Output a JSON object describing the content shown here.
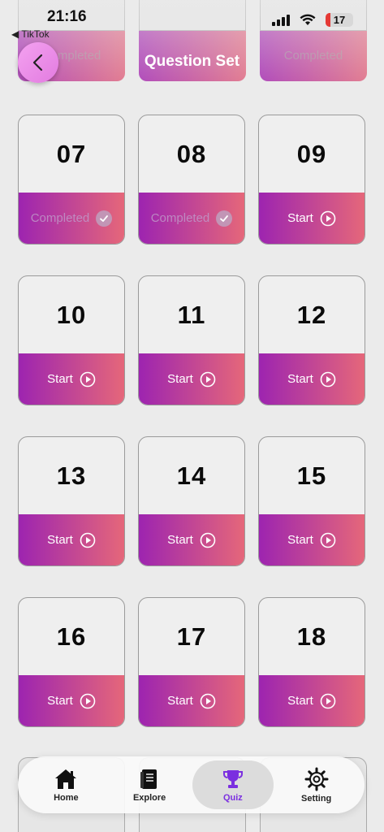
{
  "status": {
    "time": "21:16",
    "back_app": "◀ TikTok",
    "battery": "17"
  },
  "header": {
    "title": "Question Set"
  },
  "top_ghost": [
    {
      "label": "Completed"
    },
    {
      "label": ""
    },
    {
      "label": "Completed"
    }
  ],
  "cards": [
    {
      "number": "07",
      "action": "Completed",
      "status": "completed"
    },
    {
      "number": "08",
      "action": "Completed",
      "status": "completed"
    },
    {
      "number": "09",
      "action": "Start",
      "status": "start"
    },
    {
      "number": "10",
      "action": "Start",
      "status": "start"
    },
    {
      "number": "11",
      "action": "Start",
      "status": "start"
    },
    {
      "number": "12",
      "action": "Start",
      "status": "start"
    },
    {
      "number": "13",
      "action": "Start",
      "status": "start"
    },
    {
      "number": "14",
      "action": "Start",
      "status": "start"
    },
    {
      "number": "15",
      "action": "Start",
      "status": "start"
    },
    {
      "number": "16",
      "action": "Start",
      "status": "start"
    },
    {
      "number": "17",
      "action": "Start",
      "status": "start"
    },
    {
      "number": "18",
      "action": "Start",
      "status": "start"
    }
  ],
  "nav": {
    "home": "Home",
    "explore": "Explore",
    "quiz": "Quiz",
    "setting": "Setting",
    "active": "quiz"
  },
  "colors": {
    "gradient_start": "#9d24b0",
    "gradient_end": "#e5677a",
    "active_nav": "#7b2fe0"
  }
}
